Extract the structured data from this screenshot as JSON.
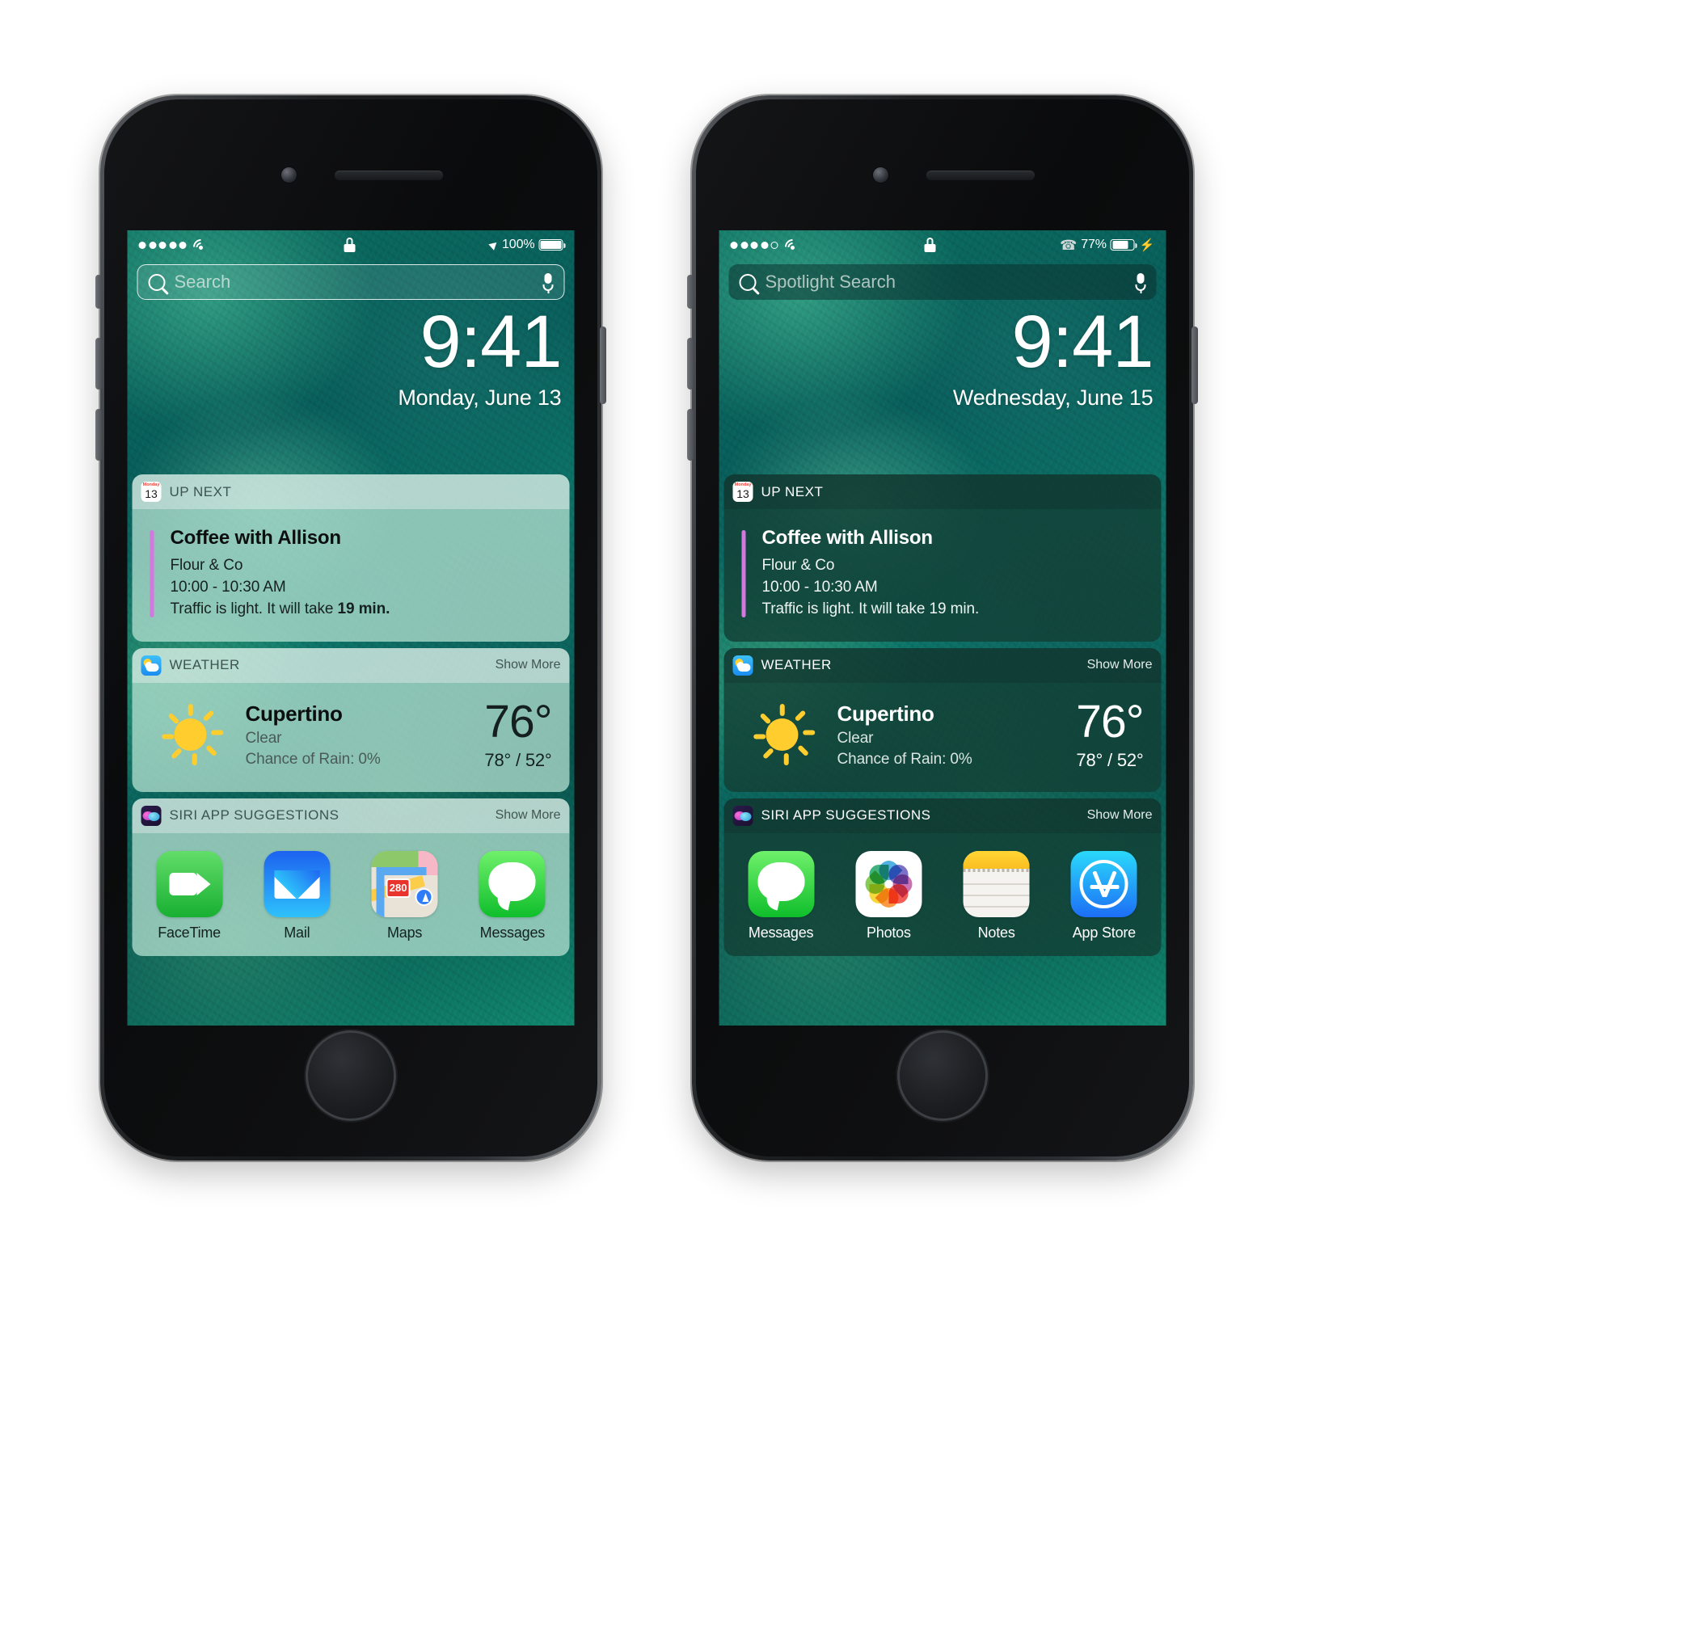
{
  "phones": [
    {
      "id": "left-phone",
      "theme": "light",
      "status_bar": {
        "signal_dots": [
          true,
          true,
          true,
          true,
          true
        ],
        "wifi_icon": "wifi-icon",
        "lock_icon": "lock-icon",
        "location_icon": "location-arrow-icon",
        "bluetooth_icon": null,
        "battery_percent": "100%",
        "battery_fill": 100,
        "charging": false
      },
      "search": {
        "placeholder": "Search",
        "mic_icon": "microphone-icon"
      },
      "clock": {
        "time": "9:41",
        "date": "Monday, June 13"
      },
      "widgets": {
        "up_next": {
          "title": "UP NEXT",
          "icon": "calendar-icon",
          "calendar_weekday": "Monday",
          "calendar_day": "13",
          "event_title": "Coffee with Allison",
          "event_place": "Flour & Co",
          "event_time": "10:00 - 10:30 AM",
          "event_traffic_prefix": "Traffic is light. It will take ",
          "event_traffic_value": "19 min.",
          "accent_color": "#d478e0"
        },
        "weather": {
          "title": "WEATHER",
          "icon": "weather-icon",
          "show_more": "Show More",
          "condition_icon": "sun-icon",
          "city": "Cupertino",
          "condition": "Clear",
          "rain": "Chance of Rain: 0%",
          "temp": "76°",
          "high_low": "78° / 52°"
        },
        "siri": {
          "title": "SIRI APP SUGGESTIONS",
          "icon": "siri-icon",
          "show_more": "Show More",
          "apps": [
            {
              "label": "FaceTime",
              "icon": "facetime-icon"
            },
            {
              "label": "Mail",
              "icon": "mail-icon"
            },
            {
              "label": "Maps",
              "icon": "maps-icon"
            },
            {
              "label": "Messages",
              "icon": "messages-icon"
            }
          ]
        }
      }
    },
    {
      "id": "right-phone",
      "theme": "dark",
      "status_bar": {
        "signal_dots": [
          true,
          true,
          true,
          true,
          false
        ],
        "wifi_icon": "wifi-icon",
        "lock_icon": "lock-icon",
        "location_icon": null,
        "bluetooth_icon": "bluetooth-icon",
        "battery_percent": "77%",
        "battery_fill": 77,
        "charging": true
      },
      "search": {
        "placeholder": "Spotlight Search",
        "mic_icon": "microphone-icon"
      },
      "clock": {
        "time": "9:41",
        "date": "Wednesday, June 15"
      },
      "widgets": {
        "up_next": {
          "title": "UP NEXT",
          "icon": "calendar-icon",
          "calendar_weekday": "Monday",
          "calendar_day": "13",
          "event_title": "Coffee with Allison",
          "event_place": "Flour & Co",
          "event_time": "10:00 - 10:30 AM",
          "event_traffic_prefix": "Traffic is light. It will take ",
          "event_traffic_value": "19 min.",
          "accent_color": "#d478e0"
        },
        "weather": {
          "title": "WEATHER",
          "icon": "weather-icon",
          "show_more": "Show More",
          "condition_icon": "sun-icon",
          "city": "Cupertino",
          "condition": "Clear",
          "rain": "Chance of Rain: 0%",
          "temp": "76°",
          "high_low": "78° / 52°"
        },
        "siri": {
          "title": "SIRI APP SUGGESTIONS",
          "icon": "siri-icon",
          "show_more": "Show More",
          "apps": [
            {
              "label": "Messages",
              "icon": "messages-icon"
            },
            {
              "label": "Photos",
              "icon": "photos-icon"
            },
            {
              "label": "Notes",
              "icon": "notes-icon"
            },
            {
              "label": "App Store",
              "icon": "appstore-icon"
            }
          ]
        }
      }
    }
  ],
  "colors": {
    "accent_event": "#d478e0",
    "sun_yellow": "#ffcd2e",
    "wallpaper_teal": "#0d6157"
  }
}
